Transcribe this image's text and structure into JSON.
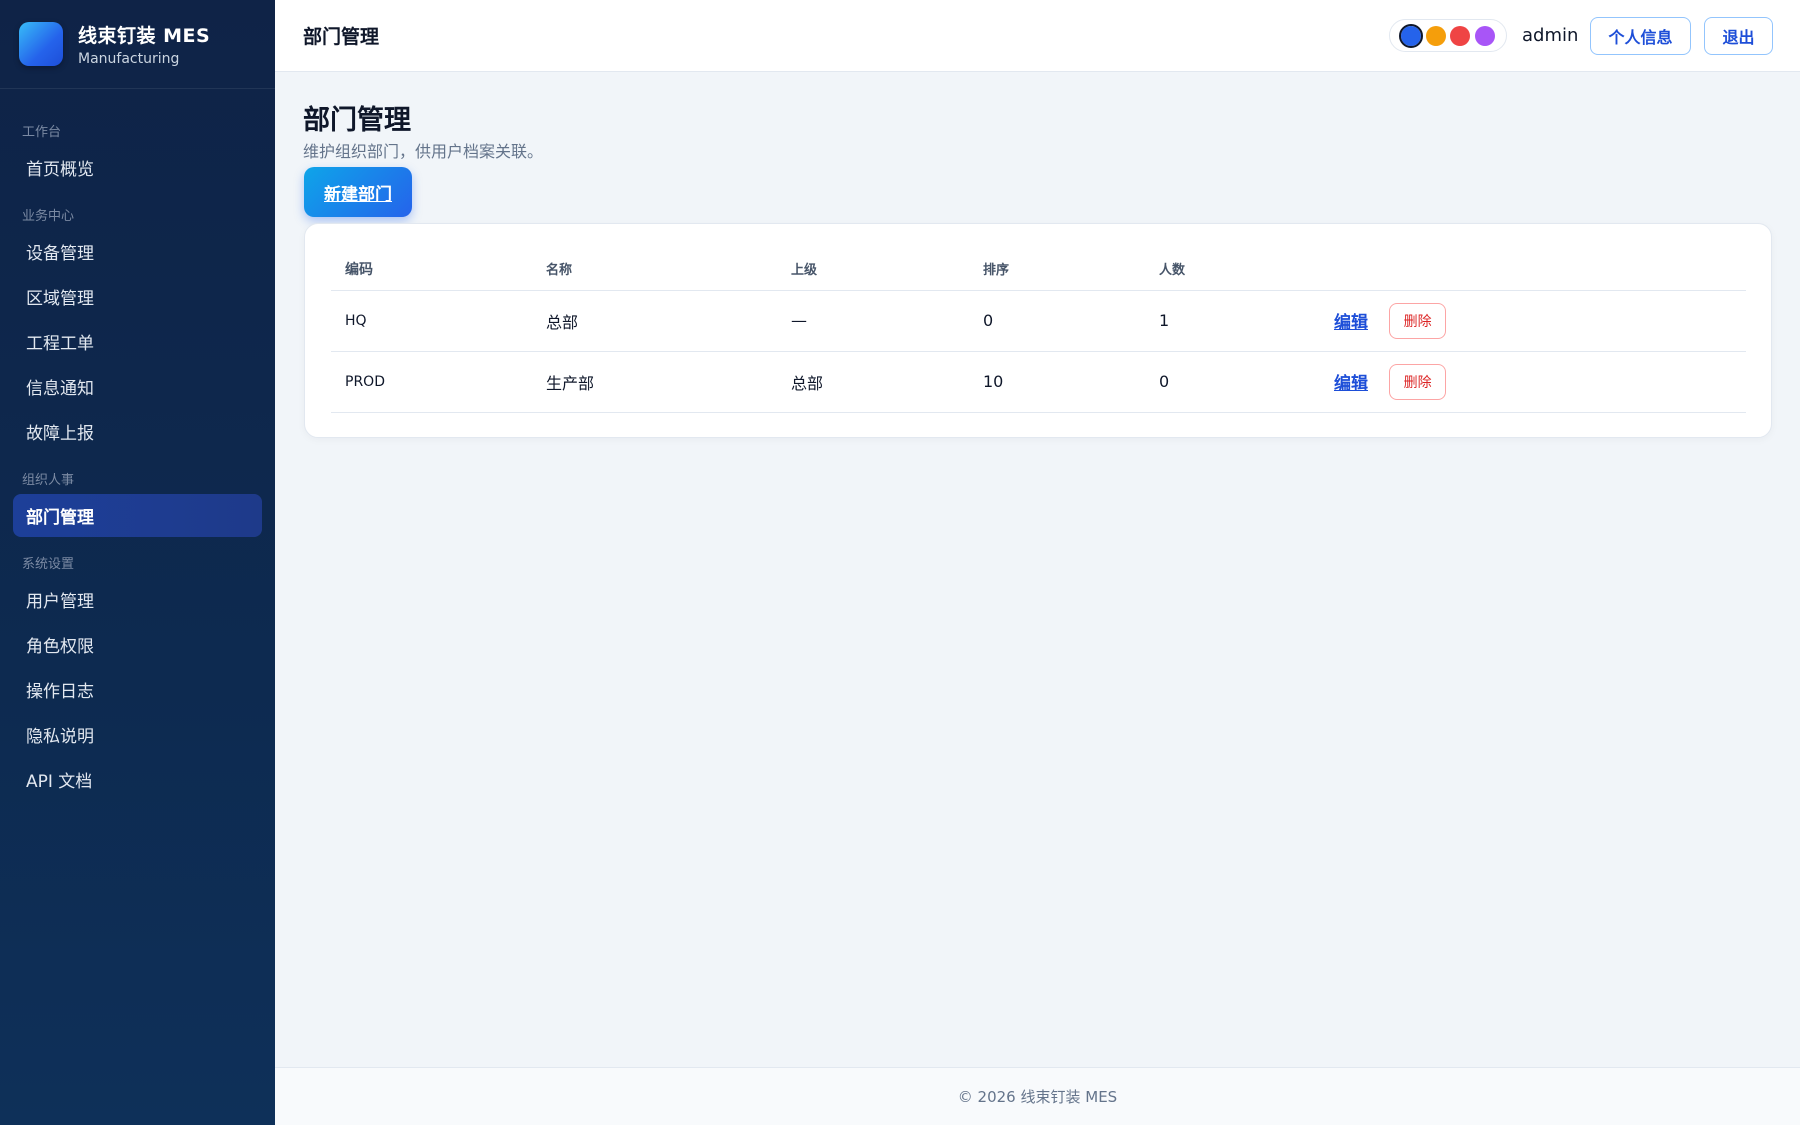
{
  "brand": {
    "title": "线束钉装 MES",
    "subtitle": "Manufacturing",
    "logo_icon": "app-logo-icon"
  },
  "sidebar": {
    "sections": [
      {
        "label": "工作台",
        "items": [
          {
            "label": "首页概览",
            "active": false
          }
        ]
      },
      {
        "label": "业务中心",
        "items": [
          {
            "label": "设备管理",
            "active": false
          },
          {
            "label": "区域管理",
            "active": false
          },
          {
            "label": "工程工单",
            "active": false
          },
          {
            "label": "信息通知",
            "active": false
          },
          {
            "label": "故障上报",
            "active": false
          }
        ]
      },
      {
        "label": "组织人事",
        "items": [
          {
            "label": "部门管理",
            "active": true
          }
        ]
      },
      {
        "label": "系统设置",
        "items": [
          {
            "label": "用户管理",
            "active": false
          },
          {
            "label": "角色权限",
            "active": false
          },
          {
            "label": "操作日志",
            "active": false
          },
          {
            "label": "隐私说明",
            "active": false
          },
          {
            "label": "API 文档",
            "active": false
          }
        ]
      }
    ]
  },
  "header": {
    "title": "部门管理",
    "theme_colors": [
      "#2563eb",
      "#f59e0b",
      "#ef4444",
      "#a855f7"
    ],
    "username": "admin",
    "profile_label": "个人信息",
    "logout_label": "退出"
  },
  "main": {
    "title": "部门管理",
    "description": "维护组织部门，供用户档案关联。",
    "new_button_label": "新建部门",
    "table": {
      "headers": [
        "编码",
        "名称",
        "上级",
        "排序",
        "人数",
        ""
      ],
      "rows": [
        {
          "code": "HQ",
          "name": "总部",
          "parent": "—",
          "sort": "0",
          "count": "1",
          "edit": "编辑",
          "delete": "删除"
        },
        {
          "code": "PROD",
          "name": "生产部",
          "parent": "总部",
          "sort": "10",
          "count": "0",
          "edit": "编辑",
          "delete": "删除"
        }
      ]
    }
  },
  "footer": {
    "text": "© 2026 线束钉装 MES"
  }
}
